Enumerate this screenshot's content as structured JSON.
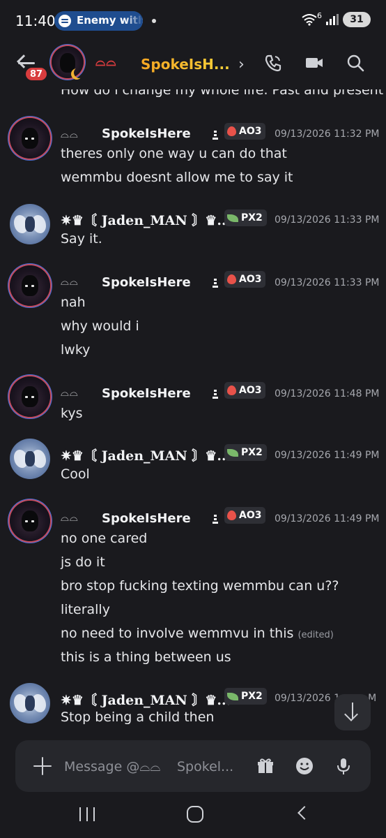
{
  "status_bar": {
    "time": "11:40",
    "media_label": "Enemy with",
    "network_label": "6",
    "battery": "31"
  },
  "header": {
    "unread_count": "87",
    "user_deco": "⌓⌓",
    "channel_name": "SpokeIsH...",
    "status_icon": "moon-icon",
    "chevron": "›"
  },
  "chat": {
    "partial_line": "How do i change my whole life. Past and present",
    "messages": [
      {
        "author": "SpokeIsHere",
        "deco": "⌓⌓",
        "tag": "AO3",
        "timestamp": "09/13/2026 11:32 PM",
        "lines": [
          "theres only one way u can do that",
          "wemmbu doesnt allow me to say it"
        ]
      },
      {
        "author": "✷♛〘 Jaden_MAN 〙♛...",
        "tag": "PX2",
        "timestamp": "09/13/2026 11:33 PM",
        "lines": [
          "Say it."
        ]
      },
      {
        "author": "SpokeIsHere",
        "deco": "⌓⌓",
        "tag": "AO3",
        "timestamp": "09/13/2026 11:33 PM",
        "lines": [
          "nah",
          "why would i",
          "lwky"
        ]
      },
      {
        "author": "SpokeIsHere",
        "deco": "⌓⌓",
        "tag": "AO3",
        "timestamp": "09/13/2026 11:48 PM",
        "lines": [
          "kys"
        ]
      },
      {
        "author": "✷♛〘 Jaden_MAN 〙♛...",
        "tag": "PX2",
        "timestamp": "09/13/2026 11:49 PM",
        "lines": [
          "Cool"
        ]
      },
      {
        "author": "SpokeIsHere",
        "deco": "⌓⌓",
        "tag": "AO3",
        "timestamp": "09/13/2026 11:49 PM",
        "lines": [
          "no one cared",
          "js do it",
          "bro stop fucking texting wemmbu can u??",
          "literally",
          "no need to involve wemmvu in this",
          "this is a thing between us"
        ],
        "edited_label": "(edited)"
      },
      {
        "author": "✷♛〘 Jaden_MAN 〙♛...",
        "tag": "PX2",
        "timestamp": "09/13/2026 1",
        "timestamp_tail": "M",
        "lines": [
          "Stop being a child then"
        ]
      }
    ]
  },
  "composer": {
    "placeholder": "Message @⌓⌓",
    "placeholder_tail": "Spokel..."
  },
  "colors": {
    "background": "#1a1a1e",
    "accent_red": "#d83c3e",
    "name_gradient_start": "#f6a623",
    "name_gradient_end": "#f7d23a",
    "tag_bg": "#2e2f35",
    "media_pill": "#1f4d8f"
  }
}
